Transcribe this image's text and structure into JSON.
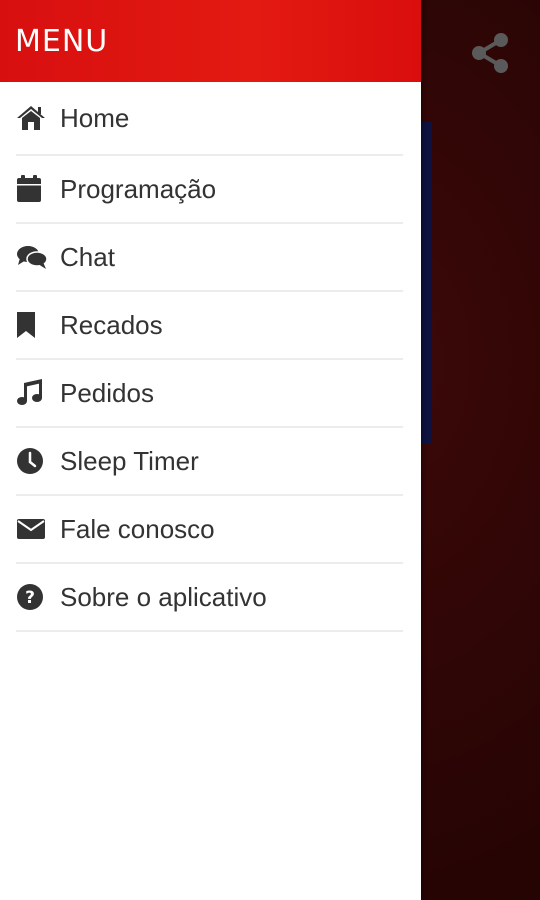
{
  "drawer": {
    "title": "MENU",
    "items": [
      {
        "label": "Home",
        "icon": "home-icon"
      },
      {
        "label": "Programação",
        "icon": "calendar-icon"
      },
      {
        "label": "Chat",
        "icon": "chat-icon"
      },
      {
        "label": "Recados",
        "icon": "bookmark-icon"
      },
      {
        "label": "Pedidos",
        "icon": "music-note-icon"
      },
      {
        "label": "Sleep Timer",
        "icon": "clock-icon"
      },
      {
        "label": "Fale conosco",
        "icon": "envelope-icon"
      },
      {
        "label": "Sobre o aplicativo",
        "icon": "question-circle-icon"
      }
    ]
  },
  "toolbar": {
    "share_icon": "share-icon"
  },
  "colors": {
    "header": "#e31a12",
    "background": "#2b0505",
    "icon": "#333333"
  }
}
